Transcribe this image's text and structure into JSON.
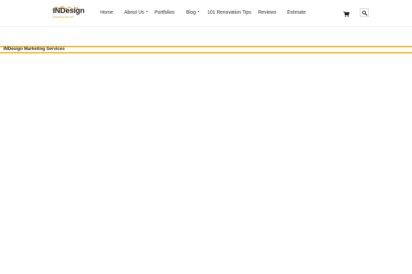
{
  "header": {
    "logo": {
      "wordmark": "INDesign",
      "tagline": "Marketing Services"
    },
    "nav": [
      {
        "label": "Home",
        "has_dropdown": false
      },
      {
        "label": "About Us",
        "has_dropdown": true
      },
      {
        "label": "Portfolios",
        "has_dropdown": false
      },
      {
        "label": "Blog",
        "has_dropdown": true
      },
      {
        "label": "101 Renovation Tips",
        "has_dropdown": false
      },
      {
        "label": "Reviews",
        "has_dropdown": false
      },
      {
        "label": "Estimate",
        "has_dropdown": false
      }
    ],
    "icons": {
      "cart": "shopping-cart-icon",
      "search": "search-icon"
    }
  },
  "title_band": {
    "title": "INDesign Marketing Services",
    "accent_color": "#f2b31f"
  },
  "colors": {
    "text": "#1f1f1f",
    "accent": "#f2b31f",
    "logo_tagline": "#d79a1e",
    "background": "#ffffff"
  }
}
